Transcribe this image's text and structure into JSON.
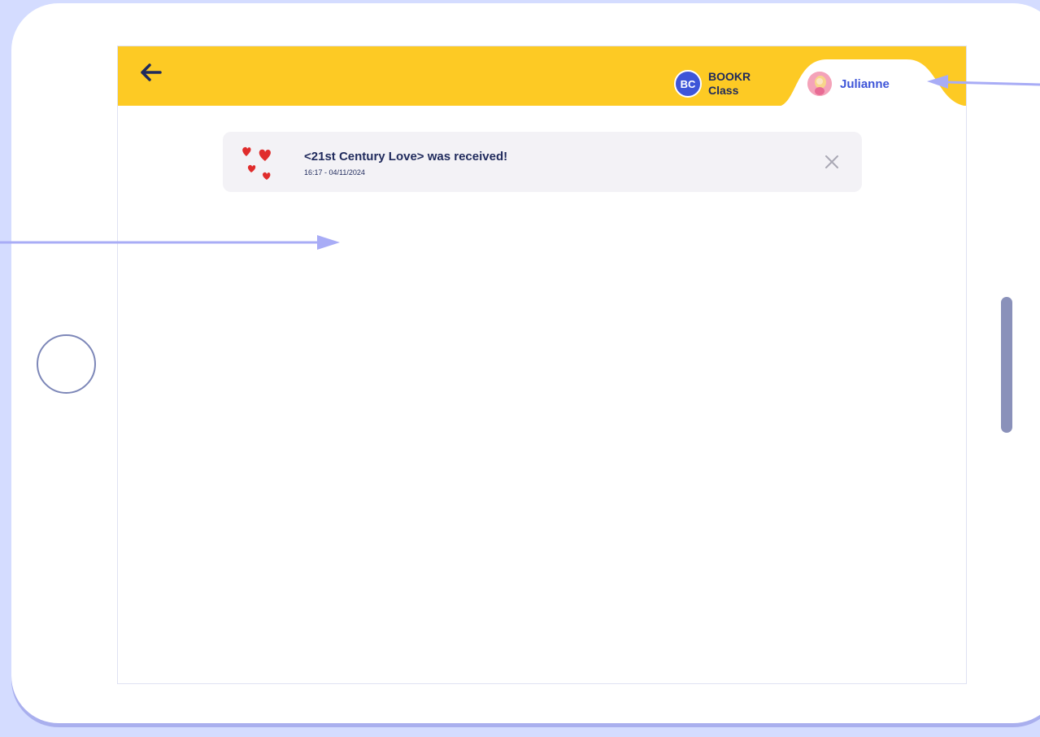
{
  "header": {
    "class_badge": "BC",
    "class_name": "BOOKR Class",
    "user_name": "Julianne"
  },
  "notification": {
    "title": "<21st Century Love> was received!",
    "timestamp": "16:17 - 04/11/2024",
    "icon": "hearts-icon"
  },
  "icons": {
    "back": "back-arrow-icon",
    "close": "close-icon",
    "avatar": "avatar"
  },
  "colors": {
    "topbar": "#fdca24",
    "accent": "#3e55d8",
    "text_dark": "#1f2a5c",
    "annotation_arrow": "#a8acf6",
    "background": "#d4dcff"
  }
}
